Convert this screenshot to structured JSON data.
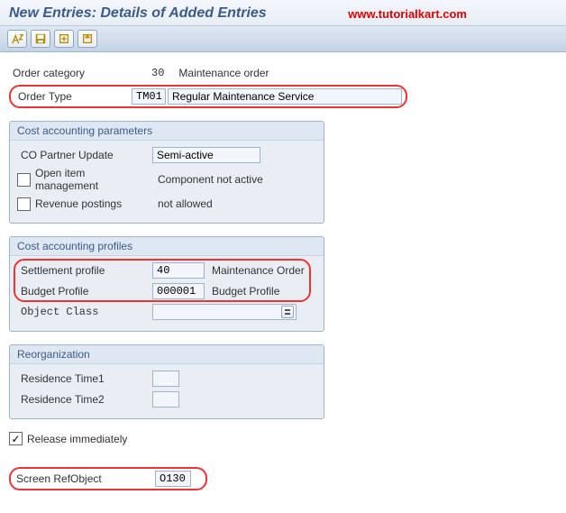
{
  "watermark": "www.tutorialkart.com",
  "title": "New Entries: Details of Added Entries",
  "order_category": {
    "label": "Order category",
    "code": "30",
    "text": "Maintenance order"
  },
  "order_type": {
    "label": "Order Type",
    "code": "TM01",
    "text": "Regular Maintenance Service"
  },
  "cost_params": {
    "title": "Cost accounting parameters",
    "co_partner": {
      "label": "CO Partner Update",
      "value": "Semi-active"
    },
    "open_item": {
      "label": "Open item management",
      "note": "Component not active"
    },
    "revenue": {
      "label": "Revenue postings",
      "note": "not allowed"
    }
  },
  "cost_profiles": {
    "title": "Cost accounting profiles",
    "settlement": {
      "label": "Settlement profile",
      "code": "40",
      "text": "Maintenance Order"
    },
    "budget": {
      "label": "Budget Profile",
      "code": "000001",
      "text": "Budget Profile"
    },
    "object_class": {
      "label": "Object Class",
      "value": ""
    }
  },
  "reorg": {
    "title": "Reorganization",
    "res1": {
      "label": "Residence Time1",
      "value": ""
    },
    "res2": {
      "label": "Residence Time2",
      "value": ""
    }
  },
  "release": {
    "label": "Release immediately",
    "checked": true
  },
  "screen_ref": {
    "label": "Screen RefObject",
    "value": "O130"
  }
}
